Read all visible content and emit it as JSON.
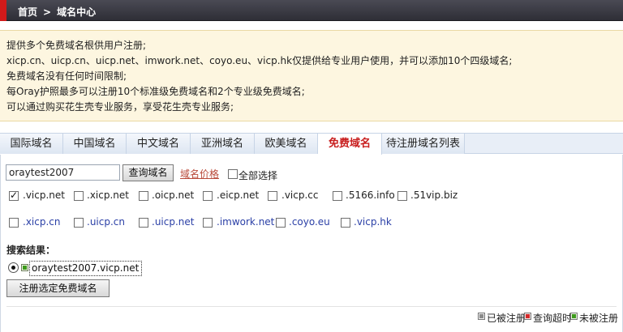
{
  "breadcrumb": {
    "home": "首页",
    "separator": ">",
    "current": "域名中心"
  },
  "notice": {
    "lines": [
      "提供多个免费域名根供用户注册;",
      "xicp.cn、uicp.cn、uicp.net、imwork.net、coyo.eu、vicp.hk仅提供给专业用户使用，并可以添加10个四级域名;",
      "免费域名没有任何时间限制;",
      "每Oray护照最多可以注册10个标准级免费域名和2个专业级免费域名;",
      "可以通过购买花生壳专业服务，享受花生壳专业服务;"
    ]
  },
  "tabs": [
    {
      "label": "国际域名",
      "active": false
    },
    {
      "label": "中国域名",
      "active": false
    },
    {
      "label": "中文域名",
      "active": false
    },
    {
      "label": "亚洲域名",
      "active": false
    },
    {
      "label": "欧美域名",
      "active": false
    },
    {
      "label": "免费域名",
      "active": true
    },
    {
      "label": "待注册域名列表",
      "active": false
    }
  ],
  "search": {
    "value": "oraytest2007",
    "button_label": "查询域名",
    "price_link": "域名价格",
    "select_all_label": "全部选择"
  },
  "suffixes_row1": [
    {
      "label": ".vicp.net",
      "checked": true
    },
    {
      "label": ".xicp.net",
      "checked": false
    },
    {
      "label": ".oicp.net",
      "checked": false
    },
    {
      "label": ".eicp.net",
      "checked": false
    },
    {
      "label": ".vicp.cc",
      "checked": false
    },
    {
      "label": ".5166.info",
      "checked": false
    },
    {
      "label": ".51vip.biz",
      "checked": false
    }
  ],
  "suffixes_row2": [
    {
      "label": ".xicp.cn",
      "checked": false
    },
    {
      "label": ".uicp.cn",
      "checked": false
    },
    {
      "label": ".uicp.net",
      "checked": false
    },
    {
      "label": ".imwork.net",
      "checked": false
    },
    {
      "label": ".coyo.eu",
      "checked": false
    },
    {
      "label": ".vicp.hk",
      "checked": false
    }
  ],
  "results": {
    "title": "搜索结果：",
    "items": [
      {
        "domain": "oraytest2007.vicp.net",
        "selected": true,
        "status": "available"
      }
    ],
    "register_button": "注册选定免费域名"
  },
  "legend": [
    {
      "label": "已被注册",
      "color": "#8a8a8a"
    },
    {
      "label": "查询超时",
      "color": "#d42a2a"
    },
    {
      "label": "未被注册",
      "color": "#3d9b1c"
    }
  ],
  "colors": {
    "accent": "#d21a1a",
    "active_tab": "#c81e1e",
    "link": "#b94a3a",
    "pro_domain": "#2a3fa6"
  }
}
